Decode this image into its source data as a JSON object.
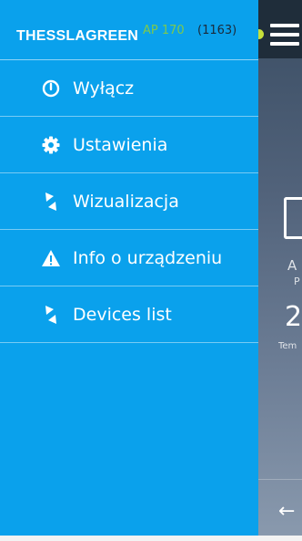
{
  "drawer": {
    "brand": "THESSLAGREEN",
    "model": "AP 170",
    "serial": "(1163)",
    "items": [
      {
        "label": "Wyłącz",
        "icon": "power-icon"
      },
      {
        "label": "Ustawienia",
        "icon": "gear-icon"
      },
      {
        "label": "Wizualizacja",
        "icon": "thesslagreen-logo-icon"
      },
      {
        "label": "Info o urządzeniu",
        "icon": "warning-icon"
      },
      {
        "label": "Devices list",
        "icon": "thesslagreen-logo-icon"
      }
    ]
  },
  "background": {
    "label_a": "A",
    "label_p": "P",
    "big_value": "2",
    "label_tem": "Tem",
    "back_arrow": "←"
  },
  "colors": {
    "drawer_bg": "#0aa1ec",
    "model_text": "#7ec94c",
    "status_dot": "#c6e03a",
    "header_bg": "#1f2d3a"
  }
}
